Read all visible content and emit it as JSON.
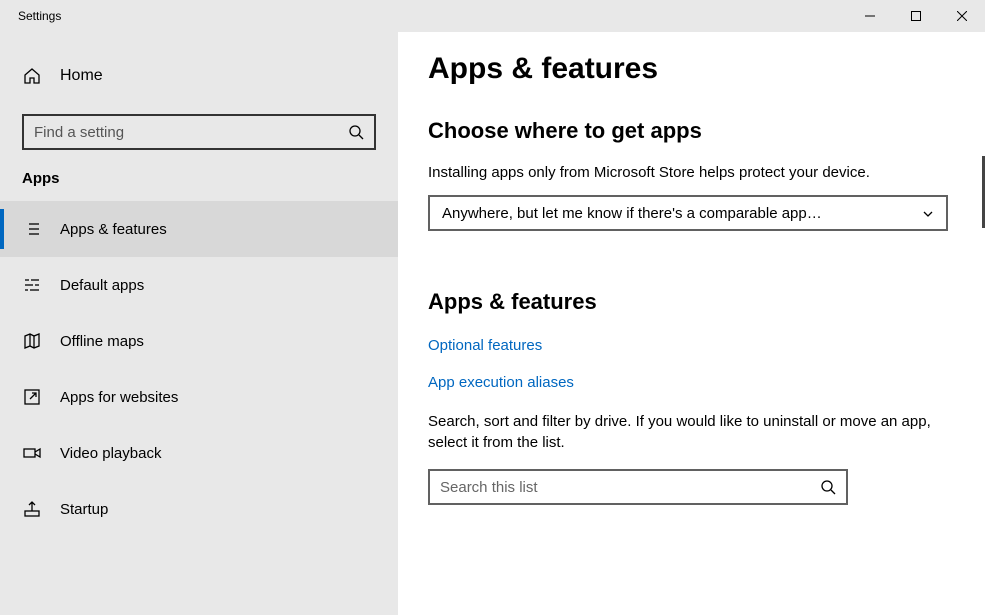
{
  "window": {
    "title": "Settings"
  },
  "sidebar": {
    "home": "Home",
    "search_placeholder": "Find a setting",
    "section": "Apps",
    "items": [
      {
        "label": "Apps & features"
      },
      {
        "label": "Default apps"
      },
      {
        "label": "Offline maps"
      },
      {
        "label": "Apps for websites"
      },
      {
        "label": "Video playback"
      },
      {
        "label": "Startup"
      }
    ]
  },
  "main": {
    "title": "Apps & features",
    "section1_heading": "Choose where to get apps",
    "section1_body": "Installing apps only from Microsoft Store helps protect your device.",
    "dropdown_value": "Anywhere, but let me know if there's a comparable app…",
    "section2_heading": "Apps & features",
    "link_optional": "Optional features",
    "link_aliases": "App execution aliases",
    "section2_body": "Search, sort and filter by drive. If you would like to uninstall or move an app, select it from the list.",
    "filter_placeholder": "Search this list"
  }
}
